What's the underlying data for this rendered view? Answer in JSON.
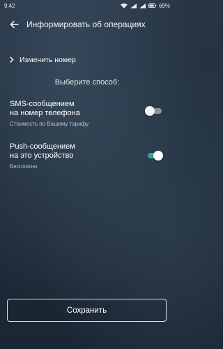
{
  "status_bar": {
    "time": "9:42",
    "battery": "69%"
  },
  "header": {
    "title": "Информировать об операциях"
  },
  "change_number": {
    "label": "Изменить номер"
  },
  "choose_method": "Выберите способ:",
  "options": [
    {
      "line1": "SMS-сообщением",
      "line2": "на номер телефона",
      "subtitle": "Стоимость по Вашему тарифу",
      "enabled": false
    },
    {
      "line1": "Push-сообщением",
      "line2": "на это устройство",
      "subtitle": "Бесплатно",
      "enabled": true
    }
  ],
  "save_button": {
    "label": "Сохранить"
  },
  "colors": {
    "toggle_on": "#2fa89c",
    "background": "#22303f"
  }
}
